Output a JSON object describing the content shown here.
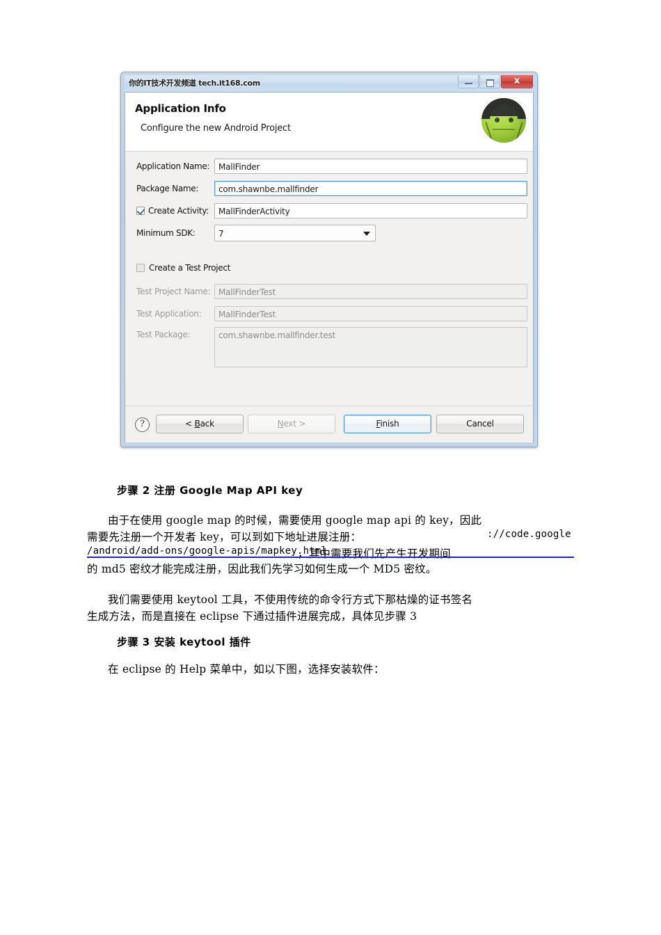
{
  "dialog": {
    "titlebar": {
      "watermark": "你的IT技术开发频道 tech.it168.com",
      "minimize_label": "Minimize",
      "maximize_label": "Restore",
      "close_label": "x"
    },
    "header": {
      "title": "Application Info",
      "subtitle": "Configure the new Android Project",
      "logo": "android-robot-icon"
    },
    "fields": [
      {
        "label": "Application Name:",
        "value": "MallFinder",
        "focused": false,
        "disabled": false
      },
      {
        "label": "Package Name:",
        "value": "com.shawnbe.mallfinder",
        "focused": true,
        "disabled": false
      },
      {
        "label": "Create Activity:",
        "value": "MallFinderActivity",
        "focused": false,
        "disabled": false
      }
    ],
    "min_sdk": {
      "label": "Minimum SDK:",
      "value": "7"
    },
    "create_activity": {
      "label": "Create Activity:",
      "checked": true
    },
    "create_test_project": {
      "label": "Create a Test Project",
      "checked": false
    },
    "test_fields": [
      {
        "label": "Test Project Name:",
        "value": "MallFinderTest"
      },
      {
        "label": "Test Application:",
        "value": "MallFinderTest"
      },
      {
        "label": "Test Package:",
        "value": "com.shawnbe.mallfinder.test"
      }
    ],
    "buttons": {
      "help": "?",
      "back_prefix": "< ",
      "back_accel": "B",
      "back_suffix": "ack",
      "next_accel": "N",
      "next_suffix": "ext >",
      "finish_accel": "F",
      "finish_suffix": "inish",
      "cancel": "Cancel"
    },
    "colors": {
      "accent_focus": "#5a9fd4",
      "default_button_border": "#4d98d4",
      "close_button": "#cf4c45",
      "android_green": "#a4d23f"
    }
  },
  "document": {
    "heading_step2": "步骤 2 注册 Google Map API key",
    "para1_line1": "由于在使用 google map 的时候，需要使用 google map api 的 key，因此",
    "para1_line2_a": "需要先注册一个开发者 key，可以到如下地址进展注册：",
    "para1_line2_b": "://code.google",
    "para1_line3_a": "/android/add-ons/google-apis/mapkey.html",
    "para1_line3_b": "，其中需要我们先产生开发期间",
    "para1_line4": "的 md5 密纹才能完成注册，因此我们先学习如何生成一个 MD5 密纹。",
    "para2_line1": "我们需要使用 keytool 工具，不使用传统的命令行方式下那枯燥的证书签名",
    "para2_line2": "生成方法，而是直接在 eclipse 下通过插件进展完成，具体见步骤 3",
    "heading_step3": "步骤 3 安装 keytool 插件",
    "para3_line1": "在 eclipse 的 Help 菜单中，如以下图，选择安装软件："
  }
}
